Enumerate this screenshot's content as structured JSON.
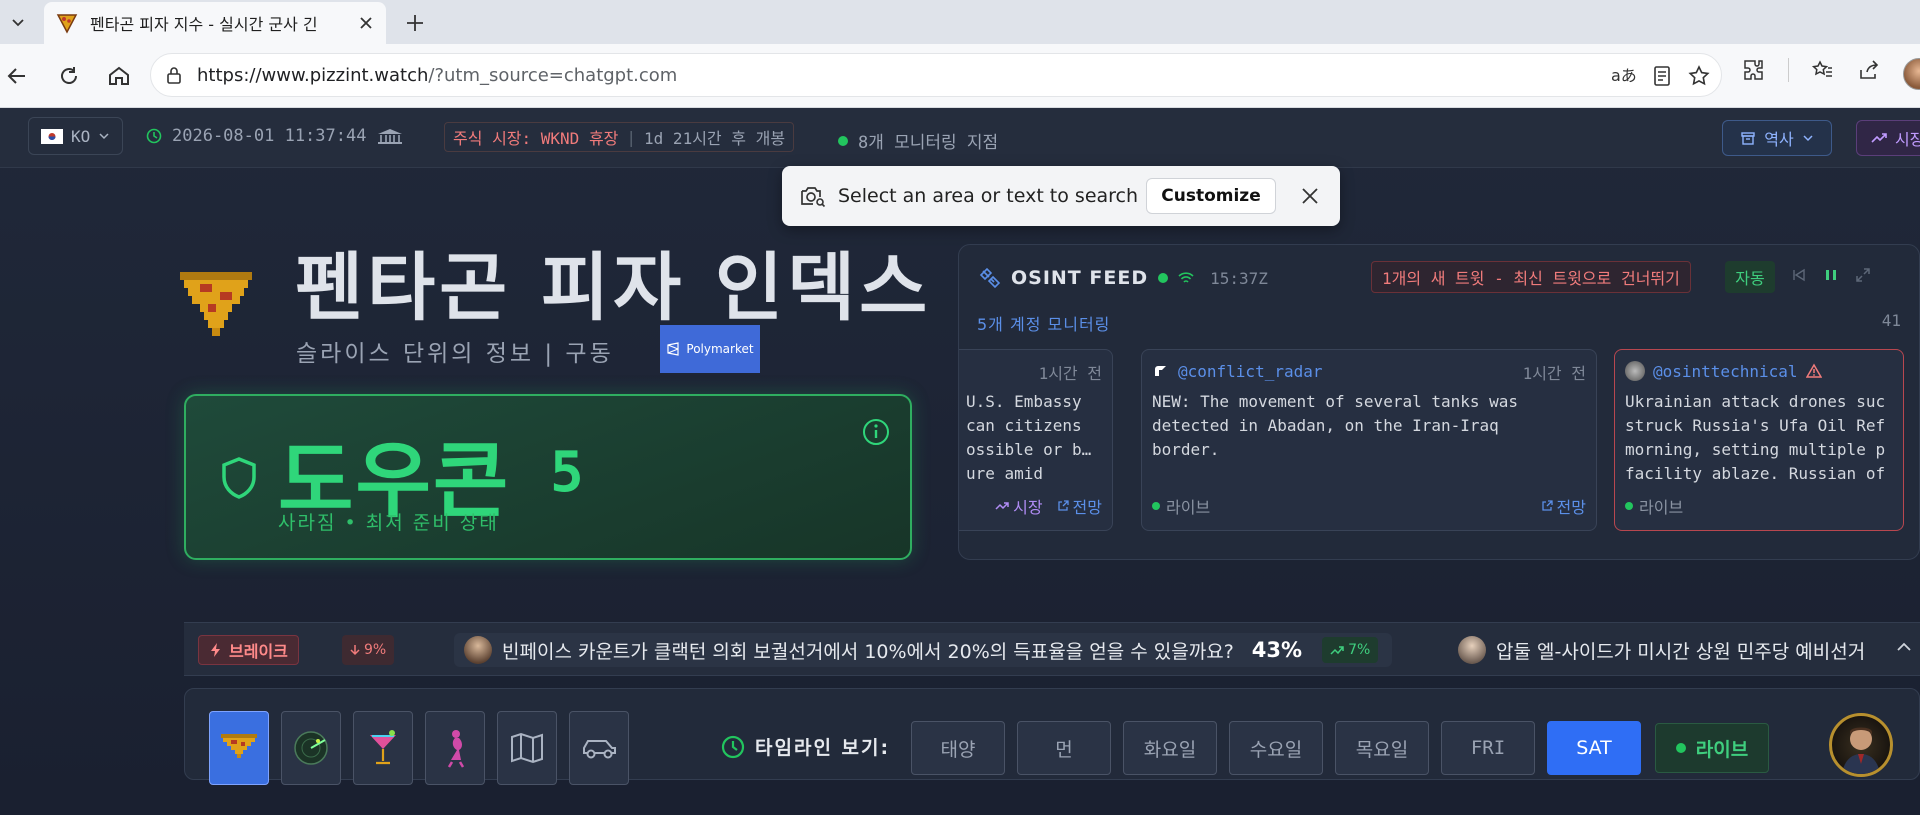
{
  "browser": {
    "tab_title": "펜타곤 피자 지수 - 실시간 군사 긴",
    "url_host": "https://www.pizzint.watch",
    "url_path": "/?utm_source=chatgpt.com"
  },
  "status": {
    "lang": "KO",
    "datetime": "2026-08-01 11:37:44",
    "market_closed": "주식 시장: WKND 휴장",
    "market_sep": "|",
    "market_opens": "1d 21시간 후 개봉",
    "monitoring": "8개 모니터링 지점",
    "history_label": "역사",
    "market_label": "시장"
  },
  "hero": {
    "title": "펜타곤 피자 인덱스",
    "subtitle": "슬라이스 단위의 정보 | 구동",
    "partner": "Polymarket"
  },
  "defcon": {
    "title": "도우콘",
    "level": "5",
    "subtitle": "사라짐 • 최저 준비 상태"
  },
  "osint": {
    "title": "OSINT FEED",
    "time": "15:37Z",
    "new_tweet": "1개의 새 트윗 - 최신 트윗으로 건너뛰기",
    "auto_label": "자동",
    "accounts": "5개 계정 모니터링",
    "count": "41",
    "tweets": [
      {
        "age": "1시간 전",
        "handle": "",
        "lines": [
          " U.S. Embassy",
          "can citizens",
          "ossible or b…",
          "ure amid"
        ],
        "market_link": "시장",
        "forecast_link": "전망"
      },
      {
        "age": "1시간 전",
        "handle": "@conflict_radar",
        "lines": [
          "NEW: The movement of several tanks was",
          "detected in Abadan, on the Iran-Iraq",
          "border."
        ],
        "live": "라이브",
        "forecast_link": "전망"
      },
      {
        "handle": "@osinttechnical",
        "lines": [
          "Ukrainian attack drones suc",
          "struck Russia's Ufa Oil Ref",
          "morning, setting multiple p",
          "facility ablaze. Russian of"
        ],
        "live": "라이브"
      }
    ]
  },
  "ticker": {
    "breaking": "브레이크",
    "breaking_change": "9%",
    "news1_text": "빈페이스 카운트가 클랙턴 의회 보궐선거에서 10%에서 20%의 득표율을 얻을 수 있을까요?",
    "news1_pct": "43%",
    "news1_change": "7%",
    "news2_text": "압둘 엘-사이드가 미시간 상원 민주당 예비선거"
  },
  "bottom": {
    "timeline_label": "타임라인 보기:",
    "days": [
      "태양",
      "먼",
      "화요일",
      "수요일",
      "목요일",
      "FRI",
      "SAT"
    ],
    "active_day_index": 6,
    "live_label": "라이브"
  },
  "popup": {
    "text": "Select an area or text to search",
    "customize": "Customize"
  },
  "colors": {
    "accent_green": "#2fd67a",
    "accent_blue": "#2f6ef5",
    "alert_red": "#f07b7b"
  }
}
